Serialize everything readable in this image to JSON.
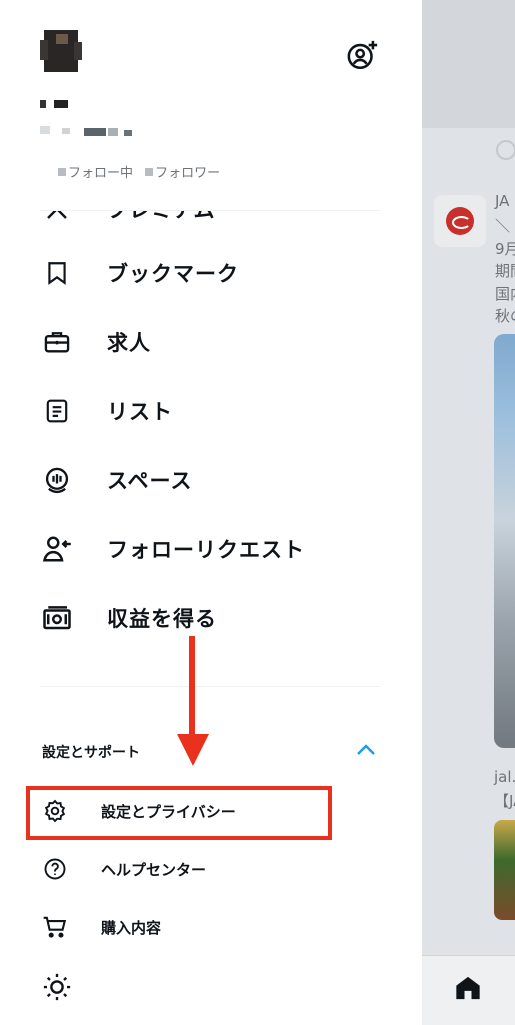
{
  "drawer": {
    "follow_stats": {
      "following_label": "フォロー中",
      "followers_label": "フォロワー"
    },
    "partial_item_label": "プレミアム",
    "menu": [
      {
        "label": "ブックマーク",
        "icon": "bookmark-icon"
      },
      {
        "label": "求人",
        "icon": "briefcase-icon"
      },
      {
        "label": "リスト",
        "icon": "list-icon"
      },
      {
        "label": "スペース",
        "icon": "spaces-icon"
      },
      {
        "label": "フォローリクエスト",
        "icon": "follow-request-icon"
      },
      {
        "label": "収益を得る",
        "icon": "monetization-icon"
      }
    ],
    "settings_section": {
      "title": "設定とサポート",
      "items": [
        {
          "label": "設定とプライバシー",
          "icon": "gear-icon"
        },
        {
          "label": "ヘルプセンター",
          "icon": "help-icon"
        },
        {
          "label": "購入内容",
          "icon": "cart-icon"
        }
      ]
    }
  },
  "timeline": {
    "tweet_lines": [
      "JA",
      "＼",
      "9月",
      "期間",
      "国内",
      "秋の"
    ],
    "link_line": "jal.",
    "bracket_line": "【JA"
  },
  "colors": {
    "annotation": "#e8321e",
    "accent": "#1d9bf0"
  }
}
